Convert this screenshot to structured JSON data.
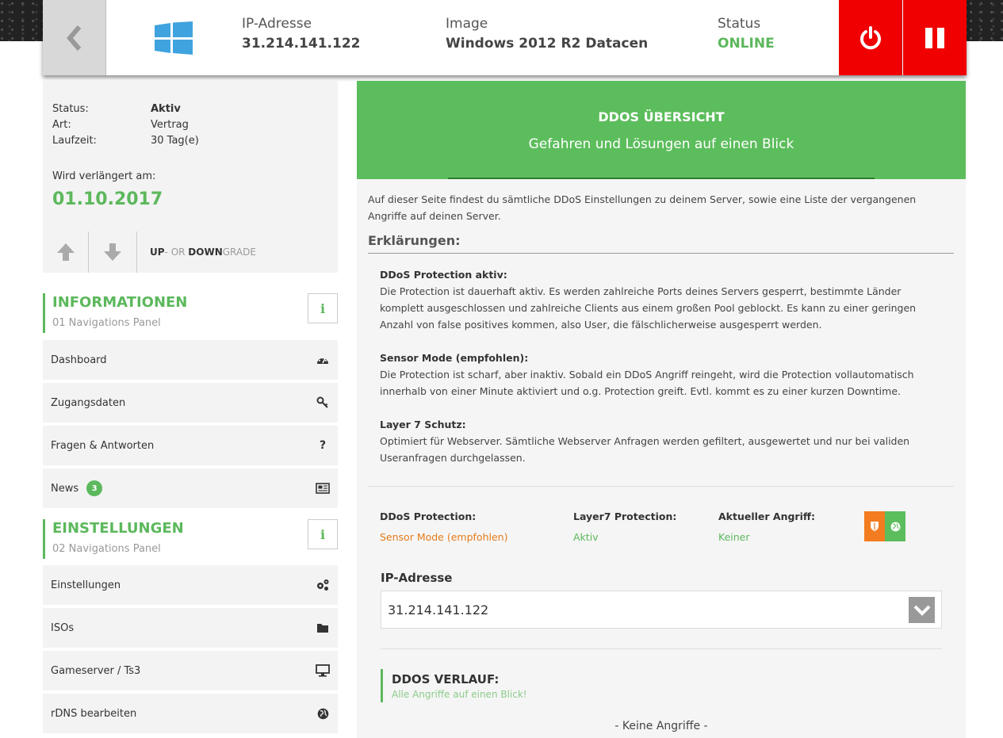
{
  "header": {
    "ip_label": "IP-Adresse",
    "ip_value": "31.214.141.122",
    "image_label": "Image",
    "image_value": "Windows 2012 R2 Datacen",
    "status_label": "Status",
    "status_value": "ONLINE",
    "status_color": "#5cb85c",
    "power_color": "#f00000"
  },
  "account": {
    "status_key": "Status:",
    "status_val": "Aktiv",
    "type_key": "Art:",
    "type_val": "Vertrag",
    "term_key": "Laufzeit:",
    "term_val": "30 Tag(e)",
    "renew_label": "Wird verlängert am:",
    "renew_date": "01.10.2017",
    "grade_up": "UP",
    "grade_sep": "- OR ",
    "grade_down": "DOWN",
    "grade_tail": "GRADE"
  },
  "sections": {
    "info": {
      "title": "INFORMATIONEN",
      "sub": "01 Navigations Panel",
      "btn": "i"
    },
    "settings": {
      "title": "EINSTELLUNGEN",
      "sub": "02 Navigations Panel",
      "btn": "i"
    }
  },
  "nav": {
    "dashboard": "Dashboard",
    "access": "Zugangsdaten",
    "faq": "Fragen & Antworten",
    "news": "News",
    "news_badge": "3",
    "settings": "Einstellungen",
    "isos": "ISOs",
    "gameserver": "Gameserver / Ts3",
    "rdns": "rDNS bearbeiten"
  },
  "main": {
    "banner_title": "DDOS ÜBERSICHT",
    "banner_sub": "Gefahren und Lösungen auf einen Blick",
    "intro": "Auf dieser Seite findest du sämtliche DDoS Einstellungen zu deinem Server, sowie eine Liste der vergangenen Angriffe auf deinen Server.",
    "expl_title": "Erklärungen:",
    "expl": [
      {
        "h": "DDoS Protection aktiv:",
        "t": "Die Protection ist dauerhaft aktiv. Es werden zahlreiche Ports deines Servers gesperrt, bestimmte Länder komplett ausgeschlossen und zahlreiche Clients aus einem großen Pool geblockt. Es kann zu einer geringen Anzahl von false positives kommen, also User, die fälschlicherweise ausgesperrt werden."
      },
      {
        "h": "Sensor Mode (empfohlen):",
        "t": "Die Protection ist scharf, aber inaktiv. Sobald ein DDoS Angriff reingeht, wird die Protection vollautomatisch innerhalb von einer Minute aktiviert und o.g. Protection greift. Evtl. kommt es zu einer kurzen Downtime."
      },
      {
        "h": "Layer 7 Schutz:",
        "t": "Optimiert für Webserver. Sämtliche Webserver Anfragen werden gefiltert, ausgewertet und nur bei validen Useranfragen durchgelassen."
      }
    ],
    "ddos_label": "DDoS Protection:",
    "ddos_value": "Sensor Mode (empfohlen)",
    "l7_label": "Layer7 Protection:",
    "l7_value": "Aktiv",
    "attack_label": "Aktueller Angriff:",
    "attack_value": "Keiner",
    "ip_label": "IP-Adresse",
    "ip_value": "31.214.141.122",
    "history_title": "DDOS VERLAUF:",
    "history_sub": "Alle Angriffe auf einen Blick!",
    "no_attacks": "- Keine Angriffe -",
    "accent_green": "#5cbd5c",
    "accent_orange": "#f47c20"
  }
}
